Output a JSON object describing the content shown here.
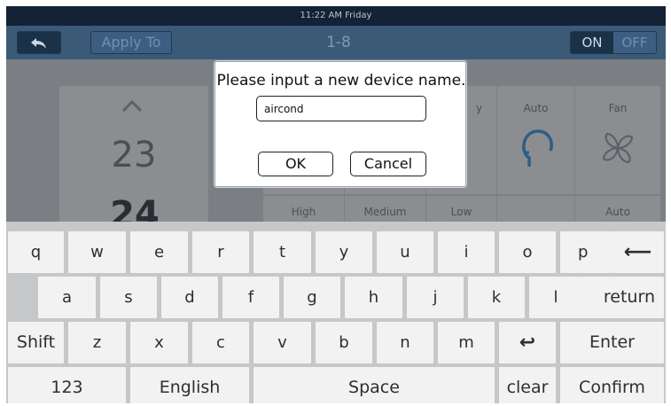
{
  "status_bar": {
    "time_day": "11:22 AM Friday"
  },
  "toolbar": {
    "apply_to_label": "Apply To",
    "page_range": "1-8",
    "on_label": "ON",
    "off_label": "OFF"
  },
  "panel": {
    "set_temp": "23",
    "room_temp_partial": "24",
    "modes": [
      {
        "label": "y"
      },
      {
        "label": "Auto"
      },
      {
        "label": "Fan"
      }
    ],
    "fan_speeds": [
      "High",
      "Medium",
      "Low",
      "",
      "Auto"
    ]
  },
  "dialog": {
    "title": "Please input a new device name.",
    "input_value": "aircond",
    "ok_label": "OK",
    "cancel_label": "Cancel"
  },
  "keyboard": {
    "row1": [
      "q",
      "w",
      "e",
      "r",
      "t",
      "y",
      "u",
      "i",
      "o",
      "p"
    ],
    "backspace_symbol": "⟵",
    "row2": [
      "a",
      "s",
      "d",
      "f",
      "g",
      "h",
      "j",
      "k",
      "l"
    ],
    "return_label": "return",
    "shift_label": "Shift",
    "row3": [
      "z",
      "x",
      "c",
      "v",
      "b",
      "n",
      "m"
    ],
    "undo_symbol": "↩",
    "enter_label": "Enter",
    "numbers_label": "123",
    "language_label": "English",
    "space_label": "Space",
    "clear_label": "clear",
    "confirm_label": "Confirm"
  },
  "colors": {
    "overlay": "#7b7e82",
    "key_face": "#f2f2f2",
    "keyboard_bg": "#c6c7c9",
    "header_dark": "#132235"
  }
}
